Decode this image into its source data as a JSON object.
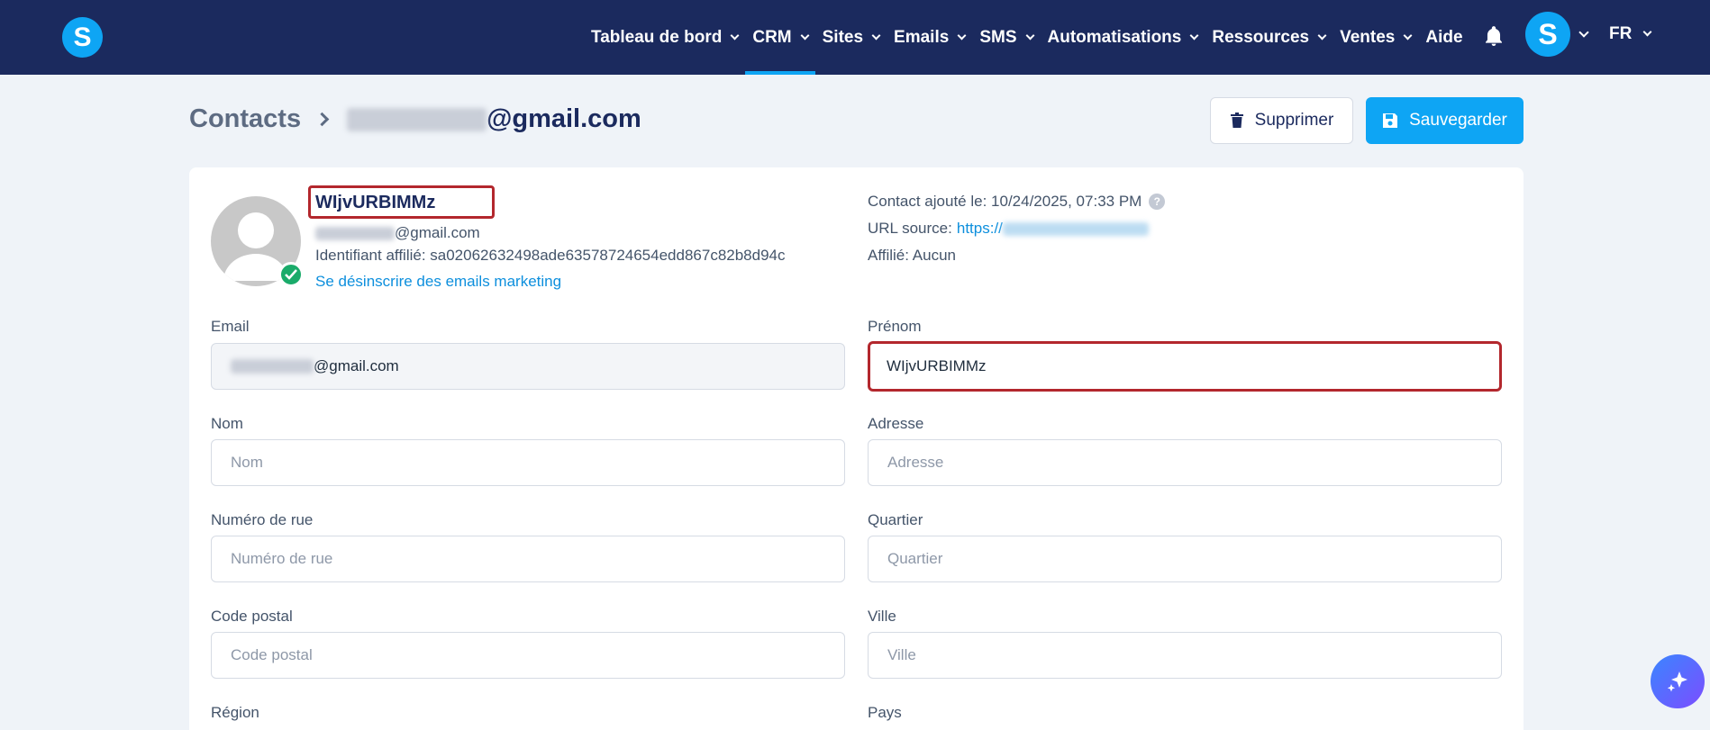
{
  "nav": {
    "items": [
      {
        "label": "Tableau de bord",
        "active": false
      },
      {
        "label": "CRM",
        "active": true
      },
      {
        "label": "Sites",
        "active": false
      },
      {
        "label": "Emails",
        "active": false
      },
      {
        "label": "SMS",
        "active": false
      },
      {
        "label": "Automatisations",
        "active": false
      },
      {
        "label": "Ressources",
        "active": false
      },
      {
        "label": "Ventes",
        "active": false
      },
      {
        "label": "Aide",
        "active": false
      }
    ],
    "logo_letter": "S",
    "user_initial": "S",
    "language": "FR",
    "accent_color": "#0ea5f4",
    "background_color": "#1b2a5e"
  },
  "header": {
    "breadcrumb_root": "Contacts",
    "breadcrumb_email_domain": "@gmail.com",
    "delete_label": "Supprimer",
    "save_label": "Sauvegarder"
  },
  "contact": {
    "name": "WIjvURBIMMz",
    "email_domain": "@gmail.com",
    "affiliate_id": "Identifiant affilié: sa02062632498ade63578724654edd867c82b8d94c",
    "unsubscribe_label": "Se désinscrire des emails marketing",
    "added_label": "Contact ajouté le: 10/24/2025, 07:33 PM",
    "source_label": "URL source:",
    "source_url_prefix": "https://",
    "affiliate_label": "Affilié: Aucun"
  },
  "form": {
    "email": {
      "label": "Email",
      "value_domain": "@gmail.com"
    },
    "prenom": {
      "label": "Prénom",
      "value": "WIjvURBIMMz"
    },
    "nom": {
      "label": "Nom",
      "placeholder": "Nom"
    },
    "adresse": {
      "label": "Adresse",
      "placeholder": "Adresse"
    },
    "numero": {
      "label": "Numéro de rue",
      "placeholder": "Numéro de rue"
    },
    "quartier": {
      "label": "Quartier",
      "placeholder": "Quartier"
    },
    "code_postal": {
      "label": "Code postal",
      "placeholder": "Code postal"
    },
    "ville": {
      "label": "Ville",
      "placeholder": "Ville"
    },
    "region": {
      "label": "Région"
    },
    "pays": {
      "label": "Pays"
    }
  }
}
